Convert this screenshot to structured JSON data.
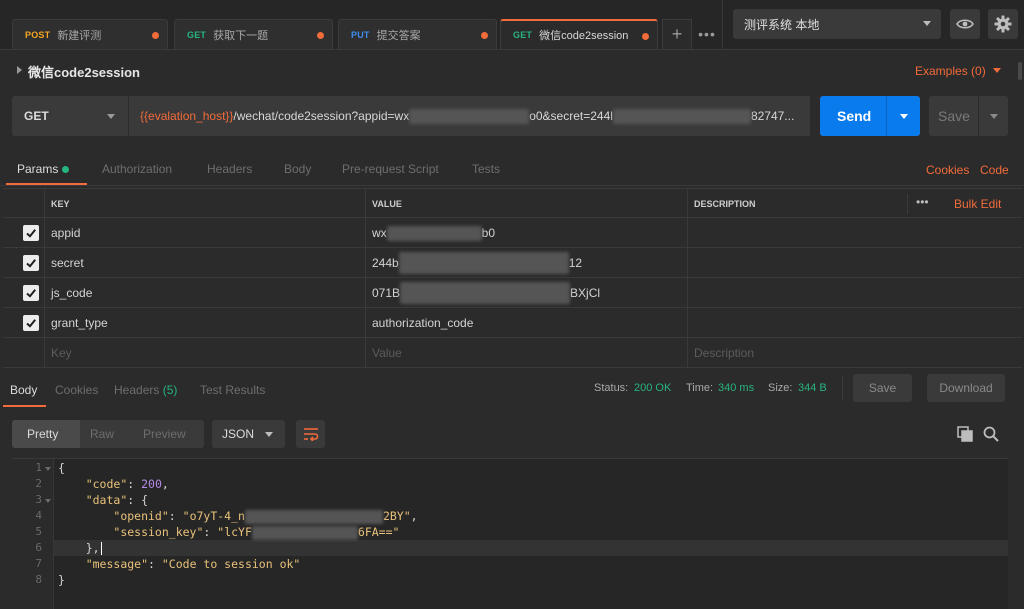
{
  "tabs": [
    {
      "method": "POST",
      "method_color": "#f5a623",
      "name": "新建评测"
    },
    {
      "method": "GET",
      "method_color": "#26b47f",
      "name": "获取下一题"
    },
    {
      "method": "PUT",
      "method_color": "#3f8cf0",
      "name": "提交答案"
    },
    {
      "method": "GET",
      "method_color": "#26b47f",
      "name": "微信code2session",
      "active": true
    }
  ],
  "tab_actions": {
    "add": "+",
    "more": "•••"
  },
  "environment": {
    "selected": "测评系统 本地"
  },
  "header_icons": [
    "eye-icon",
    "gear-icon"
  ],
  "request": {
    "title": "微信code2session",
    "examples_label": "Examples (0)",
    "method": "GET",
    "url_variable": "{{evalation_host}}",
    "url_path": "/wechat/code2session?appid=wx",
    "url_mid": "o0&secret=244l",
    "url_tail": "82747...",
    "send_label": "Send",
    "save_label": "Save"
  },
  "request_tabs": {
    "items": [
      "Params",
      "Authorization",
      "Headers",
      "Body",
      "Pre-request Script",
      "Tests"
    ],
    "active": "Params",
    "cookies": "Cookies",
    "code": "Code"
  },
  "params": {
    "headers": {
      "key": "KEY",
      "value": "VALUE",
      "description": "DESCRIPTION",
      "more": "•••",
      "bulk_edit": "Bulk Edit"
    },
    "rows": [
      {
        "key": "appid",
        "value_start": "wx",
        "value_end": "b0",
        "checked": true
      },
      {
        "key": "secret",
        "value_start": "244b",
        "value_end": "12",
        "checked": true
      },
      {
        "key": "js_code",
        "value_start": "071B",
        "value_end": "BXjCl",
        "checked": true
      },
      {
        "key": "grant_type",
        "value_start": "authorization_code",
        "value_end": "",
        "checked": true
      }
    ],
    "placeholders": {
      "key": "Key",
      "value": "Value",
      "description": "Description"
    }
  },
  "response": {
    "tabs": {
      "body": "Body",
      "cookies": "Cookies",
      "headers": "Headers",
      "headers_count": "(5)",
      "test_results": "Test Results"
    },
    "status_label": "Status:",
    "status_value": "200 OK",
    "time_label": "Time:",
    "time_value": "340 ms",
    "size_label": "Size:",
    "size_value": "344 B",
    "save_label": "Save",
    "download_label": "Download",
    "view_modes": [
      "Pretty",
      "Raw",
      "Preview"
    ],
    "format": "JSON",
    "status_color": "#26b47f"
  },
  "code_lines": {
    "l1": "{",
    "l2_key": "\"code\"",
    "l2_val": "200",
    "l3_key": "\"data\"",
    "l4_key": "\"openid\"",
    "l4_val_start": "\"o7yT-4_n",
    "l4_val_end": "2BY\"",
    "l5_key": "\"session_key\"",
    "l5_val_start": "\"lcYF",
    "l5_val_end": "6FA==\"",
    "l6": "},",
    "l7_key": "\"message\"",
    "l7_val": "\"Code to session ok\"",
    "l8": "}"
  },
  "line_numbers": [
    "1",
    "2",
    "3",
    "4",
    "5",
    "6",
    "7",
    "8"
  ]
}
